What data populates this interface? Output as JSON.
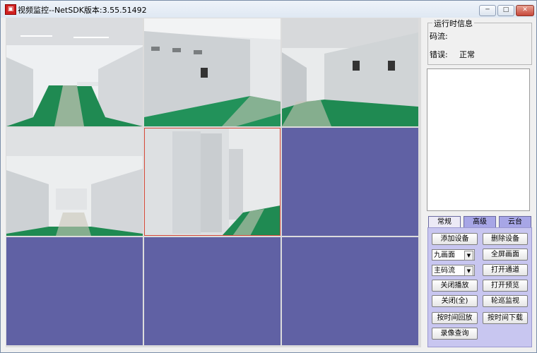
{
  "window": {
    "title": "视频监控--NetSDK版本:3.55.51492",
    "app_icon_glyph": "▣",
    "minimize_glyph": "─",
    "maximize_glyph": "□",
    "close_glyph": "✕"
  },
  "video_grid": {
    "layout": "九画面",
    "cells": [
      {
        "state": "video",
        "scene": "switchgear-room"
      },
      {
        "state": "video",
        "scene": "switchgear-room"
      },
      {
        "state": "video",
        "scene": "switchgear-room"
      },
      {
        "state": "video",
        "scene": "switchgear-room"
      },
      {
        "state": "video",
        "scene": "switchgear-room",
        "selected": true
      },
      {
        "state": "empty"
      },
      {
        "state": "empty"
      },
      {
        "state": "empty"
      },
      {
        "state": "empty"
      }
    ],
    "empty_color": "#6061a4",
    "selected_border_color": "#d64a3a"
  },
  "runtime_info": {
    "group_title": "运行时信息",
    "bitrate_label": "码流:",
    "bitrate_value": "",
    "error_label": "错误:",
    "error_value": "正常"
  },
  "tabs": [
    {
      "label": "常规",
      "style": "plain"
    },
    {
      "label": "高级",
      "style": "alt"
    },
    {
      "label": "云台",
      "style": "alt"
    }
  ],
  "controls": {
    "add_device": "添加设备",
    "delete_device": "删除设备",
    "layout_select": "九画面",
    "fullscreen": "全屏画面",
    "stream_select": "主码流",
    "open_channel": "打开通道",
    "close_playback": "关闭播放",
    "open_preview": "打开预览",
    "close_all": "关闭(全)",
    "patrol_monitor": "轮巡监视",
    "playback_by_time": "按时间回放",
    "download_by_time": "按时间下载",
    "record_query": "录像查询"
  },
  "colors": {
    "tab_panel": "#c8c6f0",
    "empty_cell": "#6061a4",
    "floor_green": "#1f8a52",
    "cabinet": "#d9dde0"
  }
}
